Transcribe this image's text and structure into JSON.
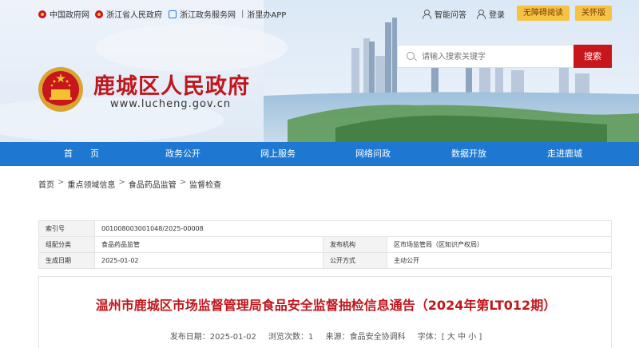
{
  "topbar": {
    "links": [
      "中国政府网",
      "浙江省人民政府",
      "浙江政务服务网",
      "浙里办APP"
    ],
    "separator": "|",
    "help": "智能问答",
    "login": "登录",
    "accessible": "无障碍阅读",
    "elderly": "关怀版"
  },
  "site": {
    "title": "鹿城区人民政府",
    "url": "www.lucheng.gov.cn"
  },
  "search": {
    "placeholder": "请输入搜索关键字",
    "button": "搜索"
  },
  "nav": [
    "首　　页",
    "政务公开",
    "网上服务",
    "网络问政",
    "数据开放",
    "走进鹿城"
  ],
  "breadcrumb": [
    "首页",
    "重点领域信息",
    "食品药品监管",
    "监督检查"
  ],
  "breadcrumb_sep": ">",
  "meta": {
    "index_label": "索引号",
    "index_value": "001008003001048/2025-00008",
    "category_label": "组配分类",
    "category_value": "食品药品监管",
    "publisher_label": "发布机构",
    "publisher_value": "区市场监管局（区知识产权局）",
    "date_label": "生成日期",
    "date_value": "2025-01-02",
    "mode_label": "公开方式",
    "mode_value": "主动公开"
  },
  "article": {
    "title": "温州市鹿城区市场监督管理局食品安全监督抽检信息通告（2024年第LT012期）",
    "publish_date": "发布日期：2025-01-02",
    "views": "浏览次数：1",
    "source": "来源：食品安全协调科",
    "fontsize": "字体：[ 大 中 小 ]"
  },
  "colors": {
    "brand_red": "#c0161c",
    "nav_blue": "#1e78d2",
    "button_yellow": "#f6c244"
  }
}
